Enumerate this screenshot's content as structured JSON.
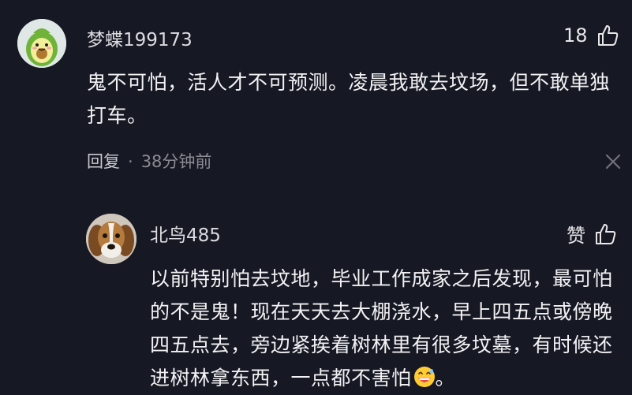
{
  "comments": [
    {
      "username": "梦蝶199173",
      "text": "鬼不可怕，活人才不可预测。凌晨我敢去坟场，但不敢单独打车。",
      "like_count": "18",
      "reply_label": "回复",
      "separator": "·",
      "time": "38分钟前",
      "avatar_icon": "avocado-avatar-icon"
    },
    {
      "username": "北鸟485",
      "text": "以前特别怕去坟地，毕业工作成家之后发现，最可怕的不是鬼！现在天天去大棚浇水，早上四五点或傍晚四五点去，旁边紧挨着树林里有很多坟墓，有时候还进树林拿东西，一点都不害怕",
      "text_end": "。",
      "like_label": "赞",
      "avatar_icon": "dog-avatar-icon",
      "emoji_icon": "grinning-sweat-emoji-icon"
    }
  ],
  "colors": {
    "background": "#161823",
    "muted": "#8a8b93",
    "text": "#f2f2f4"
  }
}
